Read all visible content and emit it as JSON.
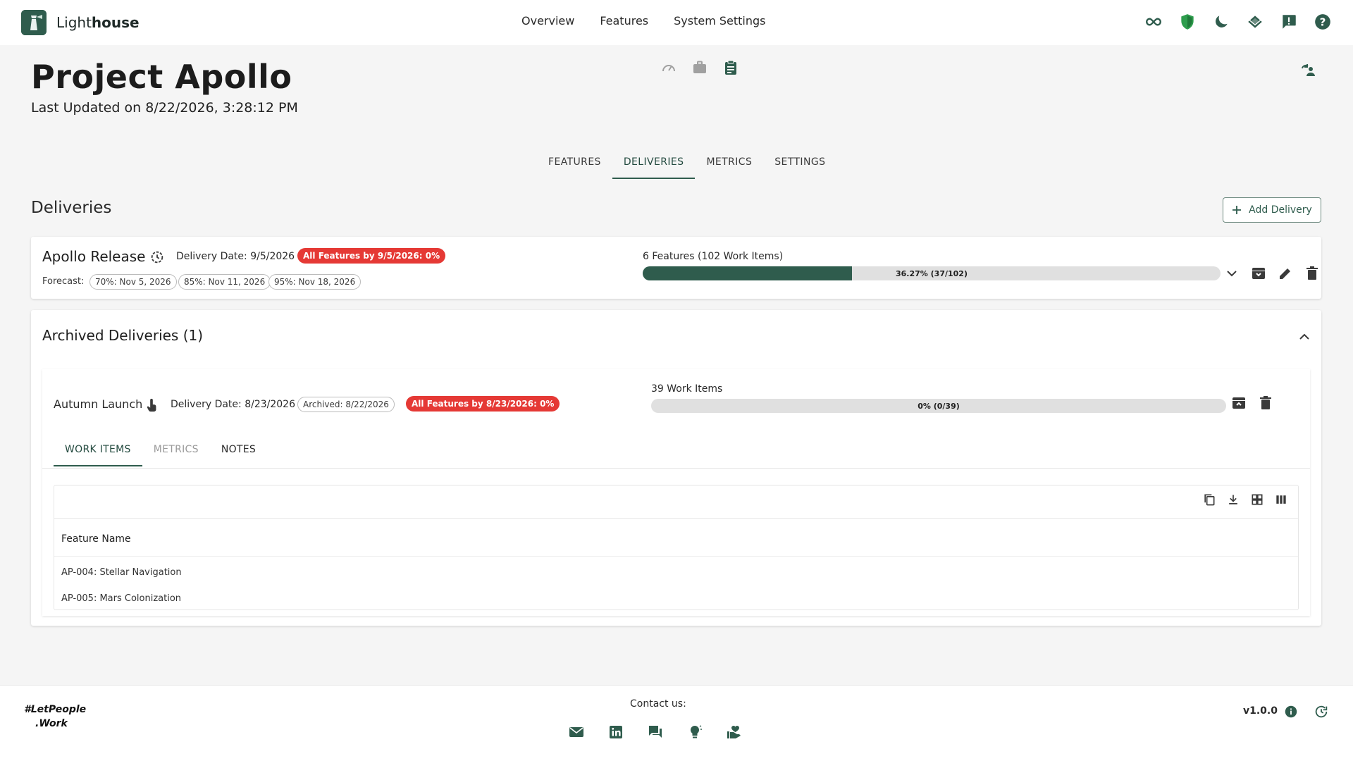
{
  "app": {
    "brand_light": "Light",
    "brand_bold": "house"
  },
  "nav": [
    "Overview",
    "Features",
    "System Settings"
  ],
  "top_icons": [
    "infinity-icon",
    "shield-icon",
    "moon-icon",
    "stack-icon",
    "feedback-icon",
    "help-icon"
  ],
  "header": {
    "title": "Project Apollo",
    "last_updated": "Last Updated on 8/22/2026, 3:28:12 PM"
  },
  "tabs": [
    "FEATURES",
    "DELIVERIES",
    "METRICS",
    "SETTINGS"
  ],
  "active_tab": "DELIVERIES",
  "section": {
    "title": "Deliveries",
    "add_label": "Add Delivery"
  },
  "delivery": {
    "name": "Apollo Release",
    "date": "Delivery Date: 9/5/2026",
    "status_chip": "All Features by 9/5/2026: 0%",
    "forecast_label": "Forecast:",
    "forecasts": [
      "70%: Nov 5, 2026",
      "85%: Nov 11, 2026",
      "95%: Nov 18, 2026"
    ],
    "summary": "6 Features (102 Work Items)",
    "progress_label": "36.27% (37/102)",
    "progress_fraction": 0.3627
  },
  "archived": {
    "title": "Archived Deliveries (1)",
    "item": {
      "name": "Autumn Launch",
      "date": "Delivery Date: 8/23/2026",
      "archived_chip": "Archived: 8/22/2026",
      "status_chip": "All Features by 8/23/2026: 0%",
      "summary": "39 Work Items",
      "progress_label": "0% (0/39)",
      "progress_fraction": 0
    },
    "sub_tabs": [
      "WORK ITEMS",
      "METRICS",
      "NOTES"
    ],
    "grid": {
      "column": "Feature Name",
      "rows": [
        "AP-004: Stellar Navigation",
        "AP-005: Mars Colonization"
      ]
    }
  },
  "footer": {
    "logo_line1": "#LetPeople",
    "logo_line2": ".Work",
    "contact_label": "Contact us:",
    "version": "v1.0.0"
  },
  "colors": {
    "accent": "#2f5c4d",
    "danger": "#e53935",
    "muted": "#9a9a9a"
  }
}
